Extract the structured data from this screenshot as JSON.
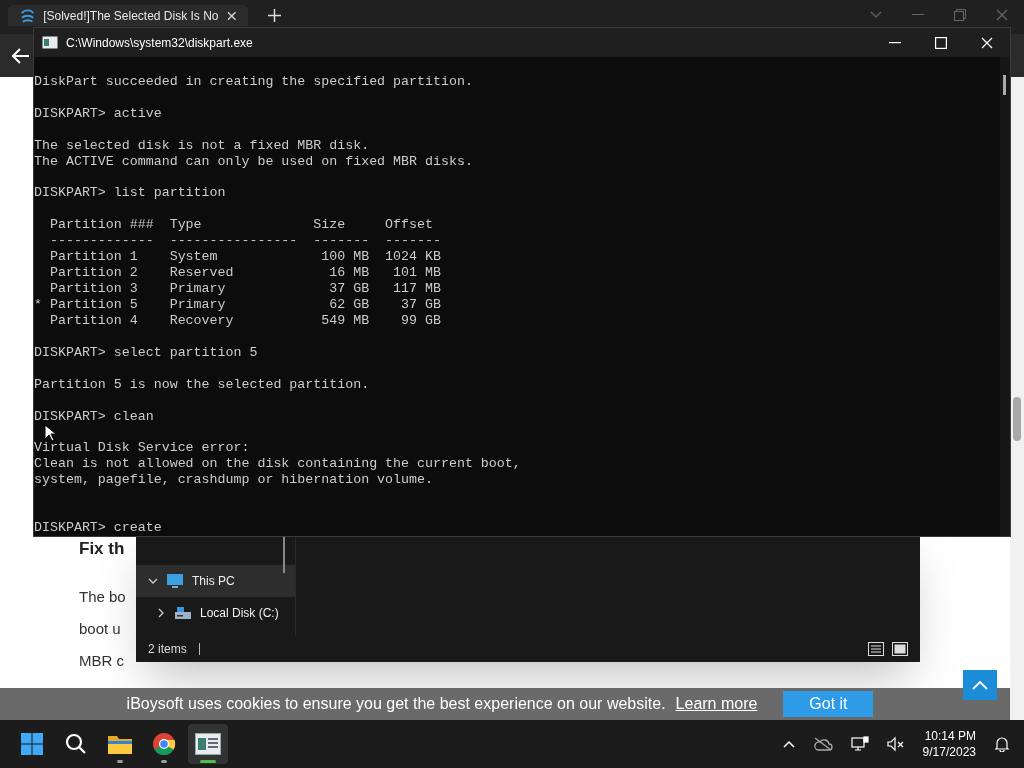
{
  "browser": {
    "tab": {
      "title": "[Solved!]The Selected Disk Is No"
    },
    "article": {
      "heading": "Fix th",
      "lines": [
        "The bo",
        "boot u",
        "MBR c"
      ]
    }
  },
  "console": {
    "title": "C:\\Windows\\system32\\diskpart.exe",
    "lines": [
      {
        "kind": "text",
        "text": "DiskPart succeeded in creating the specified partition."
      },
      {
        "kind": "blank"
      },
      {
        "kind": "text",
        "text": "DISKPART> active"
      },
      {
        "kind": "blank"
      },
      {
        "kind": "text",
        "text": "The selected disk is not a fixed MBR disk."
      },
      {
        "kind": "text",
        "text": "The ACTIVE command can only be used on fixed MBR disks."
      },
      {
        "kind": "blank"
      },
      {
        "kind": "text",
        "text": "DISKPART> list partition"
      },
      {
        "kind": "blank"
      },
      {
        "kind": "text",
        "text": "  Partition ###  Type              Size     Offset"
      },
      {
        "kind": "text",
        "text": "  -------------  ----------------  -------  -------"
      },
      {
        "kind": "text",
        "text": "  Partition 1    System             100 MB  1024 KB"
      },
      {
        "kind": "text",
        "text": "  Partition 2    Reserved            16 MB   101 MB"
      },
      {
        "kind": "text",
        "text": "  Partition 3    Primary             37 GB   117 MB"
      },
      {
        "kind": "text",
        "text": "* Partition 5    Primary             62 GB    37 GB"
      },
      {
        "kind": "text",
        "text": "  Partition 4    Recovery           549 MB    99 GB"
      },
      {
        "kind": "blank"
      },
      {
        "kind": "text",
        "text": "DISKPART> select partition 5"
      },
      {
        "kind": "blank"
      },
      {
        "kind": "text",
        "text": "Partition 5 is now the selected partition."
      },
      {
        "kind": "blank"
      },
      {
        "kind": "text",
        "text": "DISKPART> clean"
      },
      {
        "kind": "blank"
      },
      {
        "kind": "text",
        "text": "Virtual Disk Service error:"
      },
      {
        "kind": "text",
        "text": "Clean is not allowed on the disk containing the current boot,"
      },
      {
        "kind": "text",
        "text": "system, pagefile, crashdump or hibernation volume."
      },
      {
        "kind": "blank"
      },
      {
        "kind": "blank"
      },
      {
        "kind": "text",
        "text": "DISKPART> create"
      }
    ]
  },
  "explorer": {
    "tree": [
      {
        "label": "This PC",
        "selected": true,
        "expanded": true,
        "children": [
          {
            "label": "Local Disk (C:)",
            "selected": false,
            "expanded": false
          }
        ]
      }
    ],
    "status": "2 items"
  },
  "cookie": {
    "message": "iBoysoft uses cookies to ensure you get the best experience on our website.",
    "link": "Learn more",
    "button": "Got it"
  },
  "taskbar": {
    "apps": [
      {
        "kind": "start",
        "running": false,
        "active": false
      },
      {
        "kind": "search",
        "running": false,
        "active": false
      },
      {
        "kind": "explorer",
        "running": true,
        "active": false
      },
      {
        "kind": "chrome",
        "running": true,
        "active": false
      },
      {
        "kind": "console",
        "running": true,
        "active": true
      }
    ],
    "time": "10:14 PM",
    "date": "9/17/2023"
  }
}
